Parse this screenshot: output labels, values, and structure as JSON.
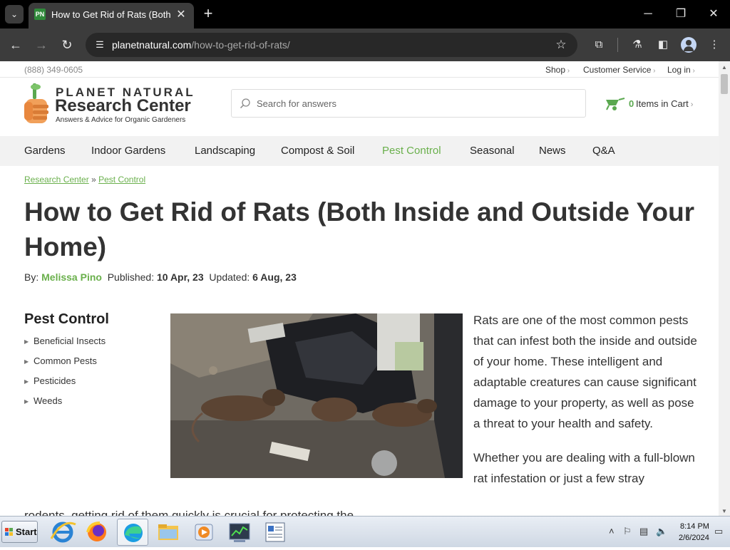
{
  "browser": {
    "tab_title": "How to Get Rid of Rats (Both Inside",
    "favicon_text": "PN",
    "url_domain": "planetnatural.com",
    "url_path": "/how-to-get-rid-of-rats/"
  },
  "utility_bar": {
    "phone": "(888) 349-0605",
    "links": [
      "Shop",
      "Customer Service",
      "Log in"
    ]
  },
  "logo": {
    "line1": "PLANET NATURAL",
    "line2": "Research Center",
    "tagline": "Answers & Advice for Organic Gardeners"
  },
  "search": {
    "placeholder": "Search for answers"
  },
  "cart": {
    "count": "0",
    "label": "Items in Cart"
  },
  "nav": {
    "items": [
      "Gardens",
      "Indoor Gardens",
      "Landscaping",
      "Compost & Soil",
      "Pest Control",
      "Seasonal",
      "News",
      "Q&A"
    ],
    "active": "Pest Control"
  },
  "breadcrumb": {
    "item1": "Research Center",
    "separator": "»",
    "item2": "Pest Control"
  },
  "article": {
    "title": "How to Get Rid of Rats (Both Inside and Outside Your Home)",
    "by_label": "By:",
    "author": "Melissa Pino",
    "published_label": "Published:",
    "published": "10 Apr, 23",
    "updated_label": "Updated:",
    "updated": "6 Aug, 23",
    "para1": "Rats are one of the most common pests that can infest both the inside and outside of your home. These intelligent and adaptable creatures can cause significant damage to your property, as well as pose a threat to your health and safety.",
    "para2": "Whether you are dealing with a full-blown rat infestation or just a few stray",
    "cut_line": "rodents, getting rid of them quickly is crucial for protecting the"
  },
  "sidebar": {
    "title": "Pest Control",
    "items": [
      "Beneficial Insects",
      "Common Pests",
      "Pesticides",
      "Weeds"
    ]
  },
  "taskbar": {
    "start": "Start",
    "time": "8:14 PM",
    "date": "2/6/2024"
  },
  "colors": {
    "accent_green": "#6ab04c",
    "chrome_dark": "#3c3c3c"
  }
}
